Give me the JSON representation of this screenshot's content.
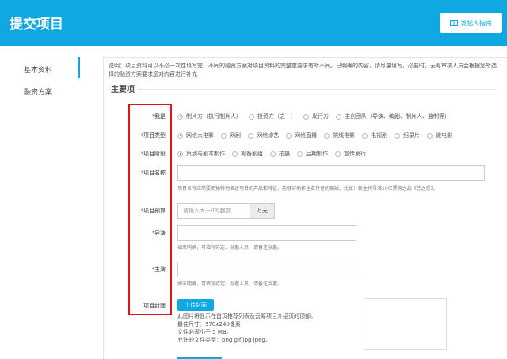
{
  "header": {
    "title": "提交项目",
    "guide_label": "发起人指南",
    "accent": "#10a8e3"
  },
  "sidebar": {
    "items": [
      {
        "label": "基本资料",
        "active": true
      },
      {
        "label": "融资方案",
        "active": false
      }
    ]
  },
  "note": "说明：项目资料可以不必一次性填写完，不同的融资方案对项目资料的完整度要求有所不同。已明确的内容，请尽量填写，必要时，云筹审核人员会根据您所选择的融资方案要求您对内容进行补充",
  "section_title": "主要项",
  "fields": {
    "role": {
      "label": "我是",
      "options": [
        "制片方（执行制片人）",
        "投资方（之一）",
        "发行方",
        "主创团队（导演、编剧、制片人、监制等）"
      ],
      "selected": 0
    },
    "type": {
      "label": "项目类型",
      "options": [
        "网络大电影",
        "网剧",
        "网络综艺",
        "网络直播",
        "院线电影",
        "电视剧",
        "纪录片",
        "微电影"
      ],
      "selected": 0
    },
    "stage": {
      "label": "项目阶段",
      "options": [
        "策划与剧本制作",
        "筹备剧组",
        "拍摄",
        "后期制作",
        "宣传发行"
      ],
      "selected": 0
    },
    "name": {
      "label": "项目名称",
      "value": "",
      "help": "项目名称应简要而独特地表达项目的产品和特征，能够好地抓住支持者的眼球。比如：新生代导演10亿票房之战《芸之恋》。"
    },
    "budget": {
      "label": "项目预算",
      "placeholder": "请输入大于0的整数",
      "unit": "万元"
    },
    "director": {
      "label": "导演",
      "value": "",
      "help": "如未明确，可填写待定、拟邀人员，请备注拟邀。"
    },
    "cast": {
      "label": "主演",
      "value": "",
      "help": "如未明确，可填写待定、拟邀人员，请备注拟邀。"
    },
    "cover": {
      "label": "项目封面",
      "upload_label": "上传封面",
      "info": [
        "此图片将显示在首页推荐列表及云筹项目介绍页的顶部。",
        "最佳尺寸：370x240像素",
        "文件必须小于 5 MB。",
        "允许的文件类型：png gif jpg jpeg。"
      ]
    }
  },
  "required_mark": "*"
}
